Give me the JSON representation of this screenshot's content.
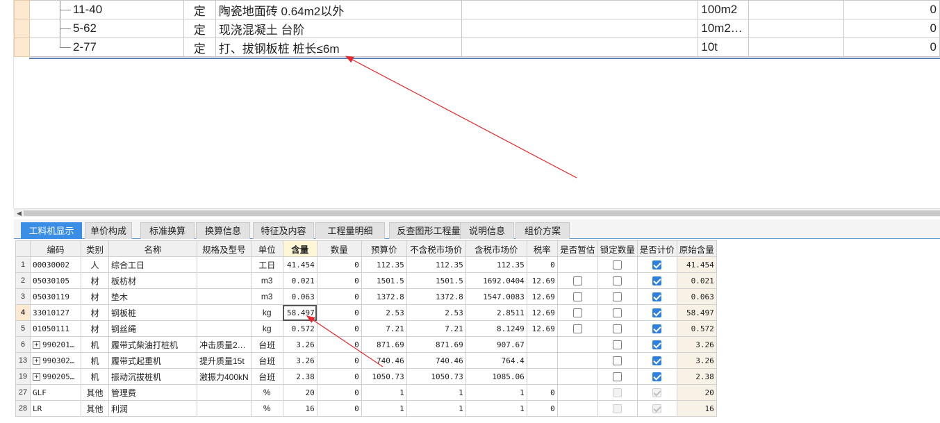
{
  "top_rows": [
    {
      "code": "11-40",
      "type": "定",
      "name": "陶瓷地面砖 0.64m2以外",
      "unit": "100m2",
      "value": "0"
    },
    {
      "code": "5-62",
      "type": "定",
      "name": "现浇混凝土 台阶",
      "unit": "10m2…",
      "value": "0"
    },
    {
      "code": "2-77",
      "type": "定",
      "name": "打、拔钢板桩 桩长≤6m",
      "unit": "10t",
      "value": "0"
    }
  ],
  "tabs": [
    "工料机显示",
    "单价构成",
    "标准换算",
    "换算信息",
    "特征及内容",
    "工程量明细",
    "反查图形工程量",
    "说明信息",
    "组价方案"
  ],
  "columns": [
    "编码",
    "类别",
    "名称",
    "规格及型号",
    "单位",
    "含量",
    "数量",
    "预算价",
    "不含税市场价",
    "含税市场价",
    "税率",
    "是否暂估",
    "锁定数量",
    "是否计价",
    "原始含量"
  ],
  "rows": [
    {
      "rn": "1",
      "code": "00030002",
      "cat": "人",
      "name": "综合工日",
      "spec": "",
      "unit": "工日",
      "qty": "41.454",
      "amount": "0",
      "budget": "112.35",
      "market_ex": "112.35",
      "market_in": "112.35",
      "tax": "0",
      "est": "none",
      "lock": "off",
      "price": "on",
      "orig": "41.454",
      "expand": false
    },
    {
      "rn": "2",
      "code": "05030105",
      "cat": "材",
      "name": "板枋材",
      "spec": "",
      "unit": "m3",
      "qty": "0.021",
      "amount": "0",
      "budget": "1501.5",
      "market_ex": "1501.5",
      "market_in": "1692.0404",
      "tax": "12.69",
      "est": "off",
      "lock": "off",
      "price": "on",
      "orig": "0.021",
      "expand": false
    },
    {
      "rn": "3",
      "code": "05030119",
      "cat": "材",
      "name": "垫木",
      "spec": "",
      "unit": "m3",
      "qty": "0.063",
      "amount": "0",
      "budget": "1372.8",
      "market_ex": "1372.8",
      "market_in": "1547.0083",
      "tax": "12.69",
      "est": "off",
      "lock": "off",
      "price": "on",
      "orig": "0.063",
      "expand": false
    },
    {
      "rn": "4",
      "code": "33010127",
      "cat": "材",
      "name": "钢板桩",
      "spec": "",
      "unit": "kg",
      "qty": "58.497",
      "amount": "0",
      "budget": "2.53",
      "market_ex": "2.53",
      "market_in": "2.8511",
      "tax": "12.69",
      "est": "off",
      "lock": "off",
      "price": "on",
      "orig": "58.497",
      "expand": false,
      "selected": true
    },
    {
      "rn": "5",
      "code": "01050111",
      "cat": "材",
      "name": "钢丝绳",
      "spec": "",
      "unit": "kg",
      "qty": "0.572",
      "amount": "0",
      "budget": "7.21",
      "market_ex": "7.21",
      "market_in": "8.1249",
      "tax": "12.69",
      "est": "off",
      "lock": "off",
      "price": "on",
      "orig": "0.572",
      "expand": false
    },
    {
      "rn": "6",
      "code": "990201…",
      "cat": "机",
      "name": "履带式柴油打桩机",
      "spec": "冲击质量2…",
      "unit": "台班",
      "qty": "3.26",
      "amount": "0",
      "budget": "871.69",
      "market_ex": "871.69",
      "market_in": "907.67",
      "tax": "",
      "est": "none",
      "lock": "off",
      "price": "on",
      "orig": "3.26",
      "expand": true
    },
    {
      "rn": "13",
      "code": "990302…",
      "cat": "机",
      "name": "履带式起重机",
      "spec": "提升质量15t",
      "unit": "台班",
      "qty": "3.26",
      "amount": "0",
      "budget": "740.46",
      "market_ex": "740.46",
      "market_in": "764.4",
      "tax": "",
      "est": "none",
      "lock": "off",
      "price": "on",
      "orig": "3.26",
      "expand": true
    },
    {
      "rn": "19",
      "code": "990205…",
      "cat": "机",
      "name": "振动沉拔桩机",
      "spec": "激振力400kN",
      "unit": "台班",
      "qty": "2.38",
      "amount": "0",
      "budget": "1050.73",
      "market_ex": "1050.73",
      "market_in": "1085.06",
      "tax": "",
      "est": "none",
      "lock": "off",
      "price": "on",
      "orig": "2.38",
      "expand": true
    },
    {
      "rn": "27",
      "code": "GLF",
      "cat": "其他",
      "name": "管理费",
      "spec": "",
      "unit": "%",
      "qty": "20",
      "amount": "0",
      "budget": "1",
      "market_ex": "1",
      "market_in": "1",
      "tax": "0",
      "est": "none",
      "lock": "dis",
      "price": "dis-on",
      "orig": "20",
      "expand": false
    },
    {
      "rn": "28",
      "code": "LR",
      "cat": "其他",
      "name": "利润",
      "spec": "",
      "unit": "%",
      "qty": "16",
      "amount": "0",
      "budget": "1",
      "market_ex": "1",
      "market_in": "1",
      "tax": "0",
      "est": "none",
      "lock": "dis",
      "price": "dis-on",
      "orig": "16",
      "expand": false
    }
  ],
  "colors": {
    "accent": "#3a8ee6",
    "arrow": "#e8262b",
    "selection": "#fde9d0"
  }
}
